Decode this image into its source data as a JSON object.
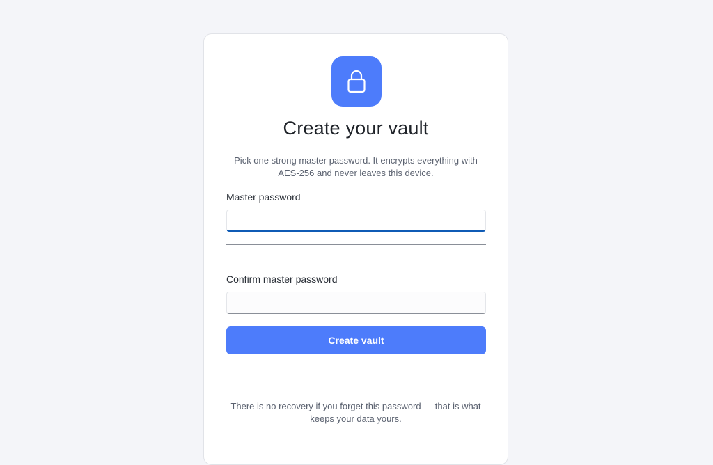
{
  "colors": {
    "page_background": "#f4f5f9",
    "card_background": "#ffffff",
    "accent": "#4d7cfb",
    "focus_underline": "#0f5bb5"
  },
  "header": {
    "icon": "lock-icon",
    "title": "Create your vault",
    "subtitle": "Pick one strong master password. It encrypts everything with AES-256 and never leaves this device."
  },
  "form": {
    "master_password": {
      "label": "Master password",
      "value": "",
      "placeholder": ""
    },
    "confirm_password": {
      "label": "Confirm master password",
      "value": "",
      "placeholder": ""
    },
    "submit_label": "Create vault"
  },
  "footer": {
    "note": "There is no recovery if you forget this password — that is what keeps your data yours."
  }
}
